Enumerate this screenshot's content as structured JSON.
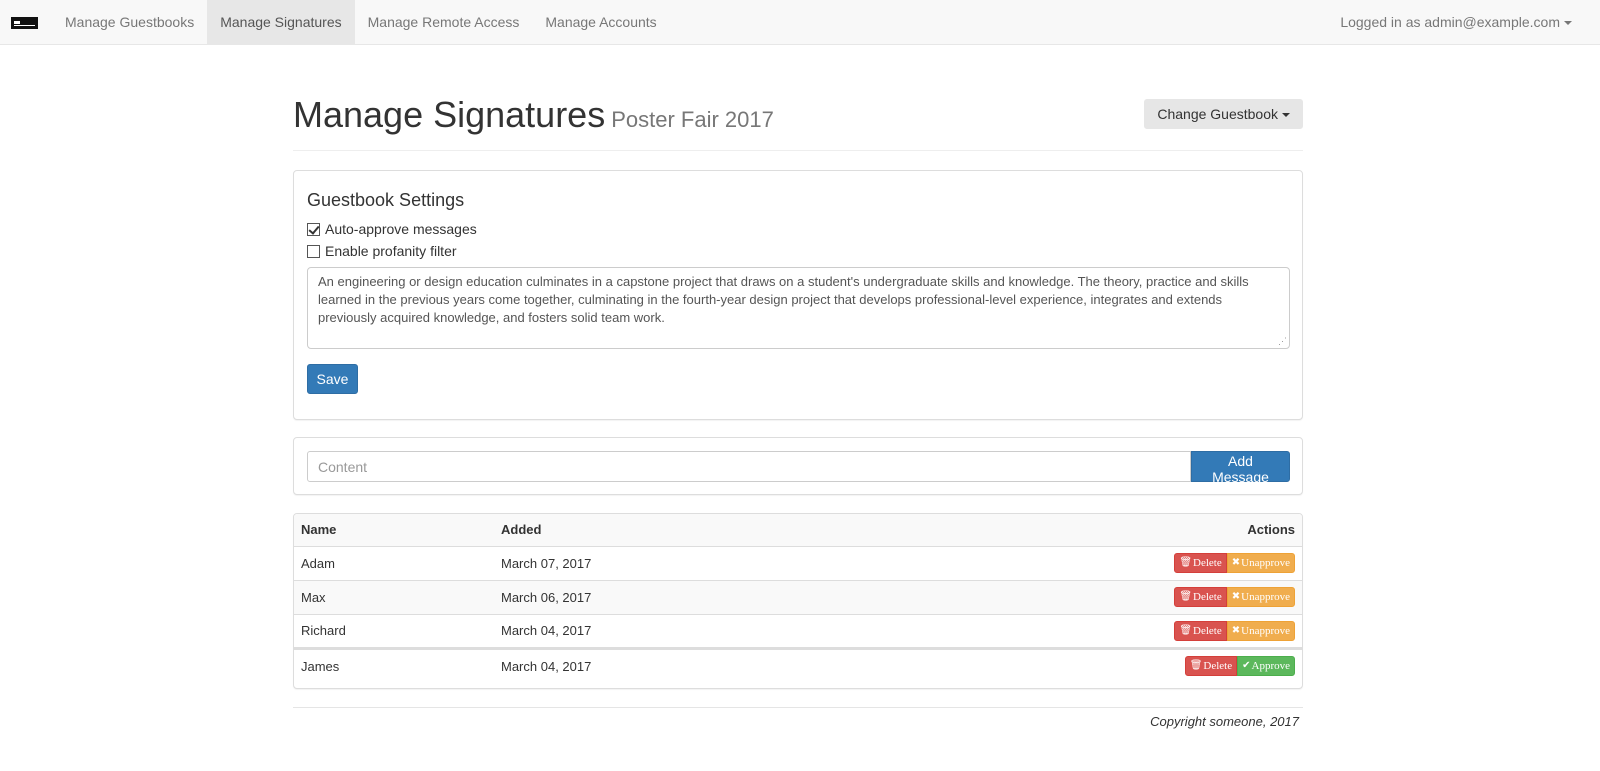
{
  "navbar": {
    "brand_icon": "logo-icon",
    "items": [
      {
        "label": "Manage Guestbooks",
        "active": false
      },
      {
        "label": "Manage Signatures",
        "active": true
      },
      {
        "label": "Manage Remote Access",
        "active": false
      },
      {
        "label": "Manage Accounts",
        "active": false
      }
    ],
    "user_label": "Logged in as admin@example.com"
  },
  "header": {
    "title": "Manage Signatures",
    "subtitle": "Poster Fair 2017",
    "change_guestbook_label": "Change Guestbook"
  },
  "settings": {
    "heading": "Guestbook Settings",
    "auto_approve_label": "Auto-approve messages",
    "auto_approve_checked": true,
    "profanity_label": "Enable profanity filter",
    "profanity_checked": false,
    "description": "An engineering or design education culminates in a capstone project that draws on a student's undergraduate skills and knowledge. The theory, practice and skills learned in the previous years come together, culminating in the fourth-year design project that develops professional-level experience, integrates and extends previously acquired knowledge, and fosters solid team work.",
    "save_label": "Save"
  },
  "add_message": {
    "placeholder": "Content",
    "button_label": "Add Message"
  },
  "table": {
    "headers": {
      "name": "Name",
      "added": "Added",
      "actions": "Actions"
    },
    "rows": [
      {
        "name": "Adam",
        "added": "March 07, 2017",
        "delete_label": "Delete",
        "toggle_label": "Unapprove"
      },
      {
        "name": "Max",
        "added": "March 06, 2017",
        "delete_label": "Delete",
        "toggle_label": "Unapprove"
      },
      {
        "name": "Richard",
        "added": "March 04, 2017",
        "delete_label": "Delete",
        "toggle_label": "Unapprove"
      },
      {
        "name": "James",
        "added": "March 04, 2017",
        "delete_label": "Delete",
        "toggle_label": "Approve"
      }
    ]
  },
  "footer": {
    "copyright": "Copyright someone, 2017"
  },
  "colors": {
    "primary": "#337ab7",
    "danger": "#d9534f",
    "warning": "#f0ad4e",
    "success": "#5cb85c"
  }
}
